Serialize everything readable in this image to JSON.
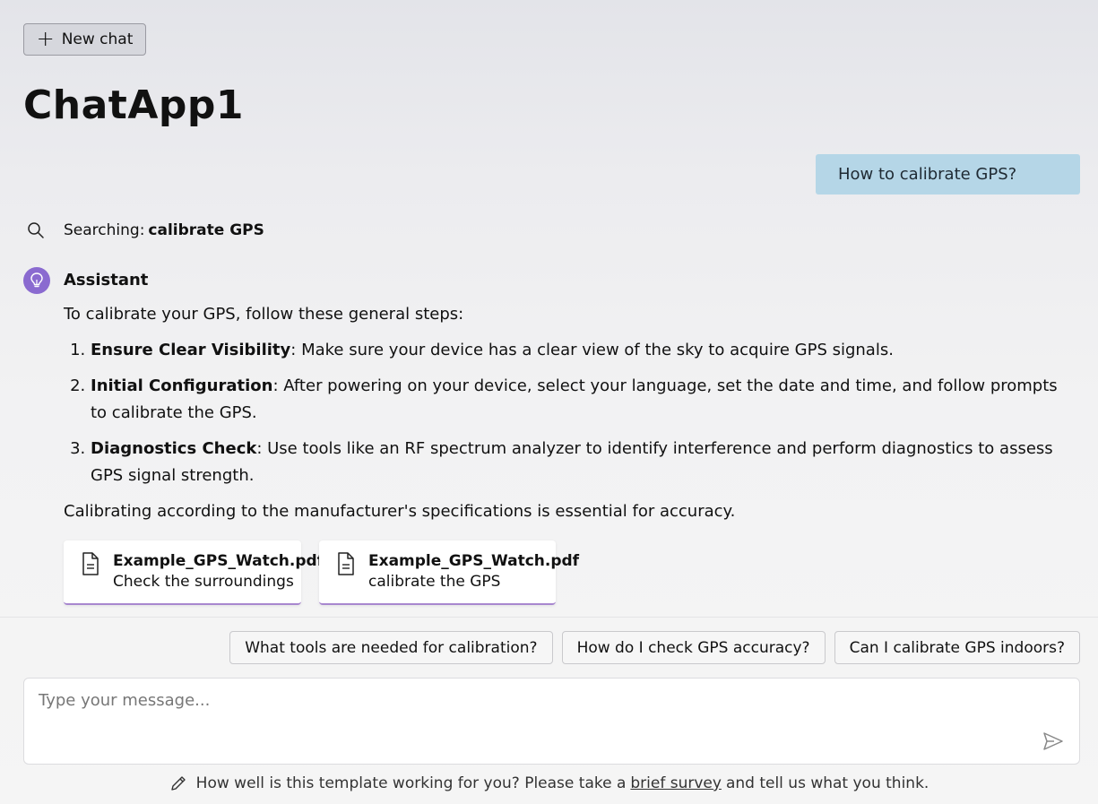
{
  "header": {
    "new_chat_label": "New chat",
    "app_title": "ChatApp1"
  },
  "conversation": {
    "user_message": "How to calibrate GPS?",
    "search": {
      "prefix": "Searching:",
      "query": "calibrate GPS"
    },
    "assistant": {
      "name": "Assistant",
      "intro": "To calibrate your GPS, follow these general steps:",
      "steps": [
        {
          "title": "Ensure Clear Visibility",
          "text": ": Make sure your device has a clear view of the sky to acquire GPS signals."
        },
        {
          "title": "Initial Configuration",
          "text": ": After powering on your device, select your language, set the date and time, and follow prompts to calibrate the GPS."
        },
        {
          "title": "Diagnostics Check",
          "text": ": Use tools like an RF spectrum analyzer to identify interference and perform diagnostics to assess GPS signal strength."
        }
      ],
      "outro": "Calibrating according to the manufacturer's specifications is essential for accuracy.",
      "citations": [
        {
          "file": "Example_GPS_Watch.pdf",
          "desc": "Check the surroundings"
        },
        {
          "file": "Example_GPS_Watch.pdf",
          "desc": "calibrate the GPS"
        }
      ]
    }
  },
  "suggestions": [
    "What tools are needed for calibration?",
    "How do I check GPS accuracy?",
    "Can I calibrate GPS indoors?"
  ],
  "composer": {
    "placeholder": "Type your message..."
  },
  "footer": {
    "before": "How well is this template working for you? Please take a",
    "link": "brief survey",
    "after": "and tell us what you think."
  },
  "icons": {
    "new_chat": "plus-icon",
    "search": "search-icon",
    "assistant": "lightbulb-icon",
    "citation": "document-icon",
    "send": "send-icon",
    "footer": "pencil-icon"
  },
  "colors": {
    "user_bubble": "#b5d6e7",
    "assistant_avatar": "#8a6ad0",
    "citation_accent": "#a887cf"
  }
}
